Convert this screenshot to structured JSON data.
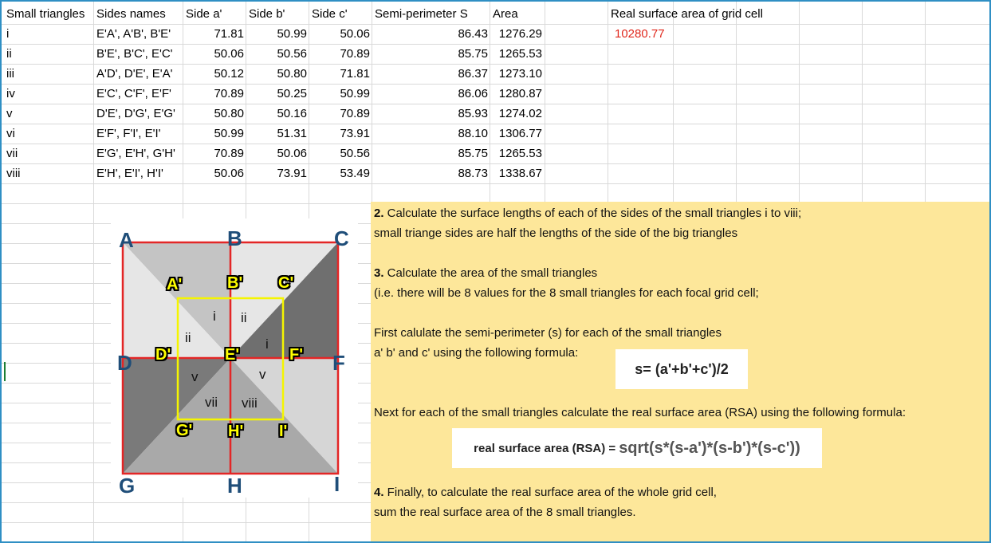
{
  "table": {
    "headers": [
      "Small triangles",
      "Sides names",
      "Side a'",
      "Side b'",
      "Side c'",
      "Semi-perimeter S",
      "Area"
    ],
    "rows": [
      [
        "i",
        "E'A', A'B', B'E'",
        "71.81",
        "50.99",
        "50.06",
        "86.43",
        "1276.29"
      ],
      [
        "ii",
        "B'E', B'C', E'C'",
        "50.06",
        "50.56",
        "70.89",
        "85.75",
        "1265.53"
      ],
      [
        "iii",
        "A'D', D'E', E'A'",
        "50.12",
        "50.80",
        "71.81",
        "86.37",
        "1273.10"
      ],
      [
        "iv",
        "E'C', C'F', E'F'",
        "70.89",
        "50.25",
        "50.99",
        "86.06",
        "1280.87"
      ],
      [
        "v",
        "D'E', D'G', E'G'",
        "50.80",
        "50.16",
        "70.89",
        "85.93",
        "1274.02"
      ],
      [
        "vi",
        "E'F', F'I', E'I'",
        "50.99",
        "51.31",
        "73.91",
        "88.10",
        "1306.77"
      ],
      [
        "vii",
        "E'G', E'H', G'H'",
        "70.89",
        "50.06",
        "50.56",
        "85.75",
        "1265.53"
      ],
      [
        "viii",
        "E'H', E'I', H'I'",
        "50.06",
        "73.91",
        "53.49",
        "88.73",
        "1338.67"
      ]
    ],
    "rsa_header": "Real surface area of grid cell",
    "rsa_value": "10280.77"
  },
  "diagram": {
    "corners": [
      "A",
      "B",
      "C",
      "D",
      "F",
      "G",
      "H",
      "I"
    ],
    "points": [
      "A'",
      "B'",
      "C'",
      "D'",
      "E'",
      "F'",
      "G'",
      "H'",
      "I'"
    ],
    "triangle_labels": [
      "i",
      "ii",
      "ii",
      "i",
      "v",
      "v",
      "vii",
      "viii"
    ],
    "colors": {
      "light": "#e6e6e6",
      "lightgray": "#c4c4c4",
      "midgray": "#a9a9a9",
      "dark": "#6f6f6f",
      "darker": "#7a7a7a",
      "edge_red": "#e32626",
      "inner_yellow": "#f5f500"
    }
  },
  "instructions": {
    "step2_num": "2.",
    "step2_line1": " Calculate the surface lengths of each of the sides of the small triangles i to viii;",
    "step2_line2": "small triange sides are half the lengths of the side of the big triangles",
    "step3_num": "3.",
    "step3_line1": " Calculate the area of the small triangles",
    "step3_line2": "(i.e. there will be 8 values for the 8 small triangles for each focal grid cell;",
    "step3_line3": "First calulate the semi-perimeter (s) for  each of the small triangles",
    "step3_line4": " a' b' and c'  using the following formula:",
    "formula_s": "s= (a'+b'+c')/2",
    "step3_line5": "Next for each of the small triangles calculate the real surface area  (RSA) using the following formula:",
    "formula_rsa_label": "real surface area (RSA)  =",
    "formula_rsa_expr": "sqrt(s*(s-a')*(s-b')*(s-c'))",
    "step4_num": "4.",
    "step4_line1": " Finally, to calculate the real surface area of the whole grid cell,",
    "step4_line2": "sum the real surface area of the 8 small triangles."
  }
}
